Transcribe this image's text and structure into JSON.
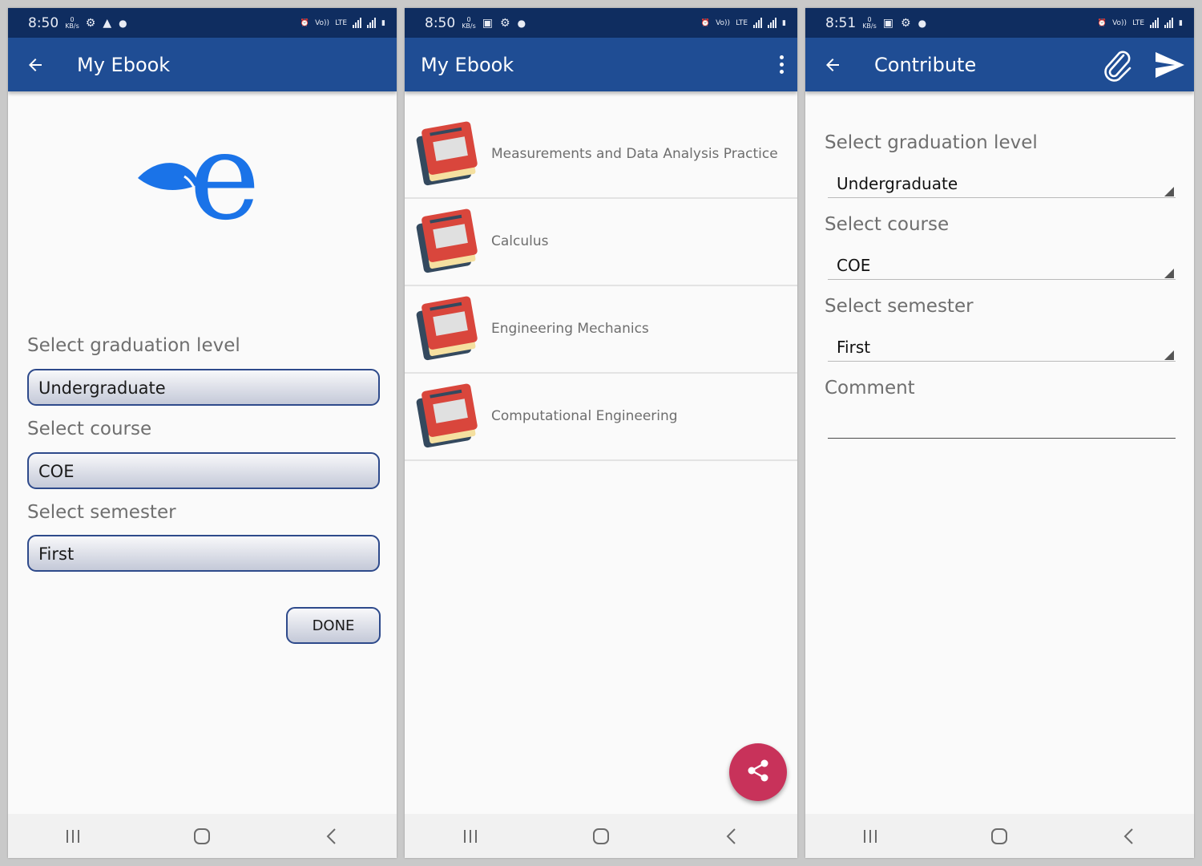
{
  "screens": [
    {
      "status": {
        "time": "8:50",
        "kb_value": "0",
        "kb_unit": "KB/s",
        "volte": "Vo))",
        "lte": "LTE"
      },
      "appbar": {
        "title": "My Ebook"
      },
      "logo_letter": "e",
      "fields": [
        {
          "label": "Select graduation level",
          "value": "Undergraduate"
        },
        {
          "label": "Select course",
          "value": "COE"
        },
        {
          "label": "Select semester",
          "value": "First"
        }
      ],
      "done_label": "DONE"
    },
    {
      "status": {
        "time": "8:50",
        "kb_value": "0",
        "kb_unit": "KB/s",
        "volte": "Vo))",
        "lte": "LTE"
      },
      "appbar": {
        "title": "My Ebook"
      },
      "books": [
        "Measurements and Data Analysis Practice",
        "Calculus",
        "Engineering Mechanics",
        "Computational Engineering"
      ]
    },
    {
      "status": {
        "time": "8:51",
        "kb_value": "0",
        "kb_unit": "KB/s",
        "volte": "Vo))",
        "lte": "LTE"
      },
      "appbar": {
        "title": "Contribute"
      },
      "fields": [
        {
          "label": "Select graduation level",
          "value": "Undergraduate"
        },
        {
          "label": "Select course",
          "value": "COE"
        },
        {
          "label": "Select semester",
          "value": "First"
        }
      ],
      "comment_label": "Comment",
      "comment_value": ""
    }
  ],
  "icons": {
    "back": "arrow-left-icon",
    "menu": "more-vert-icon",
    "attach": "paperclip-icon",
    "send": "send-icon",
    "share": "share-icon",
    "book": "book-icon",
    "nav_recents": "recents-icon",
    "nav_home": "home-icon",
    "nav_back": "nav-back-icon"
  },
  "colors": {
    "status_bar": "#0f2d60",
    "app_bar": "#1f4d94",
    "fab": "#c8325a",
    "logo": "#1a73e8",
    "book_red": "#d9463c"
  }
}
